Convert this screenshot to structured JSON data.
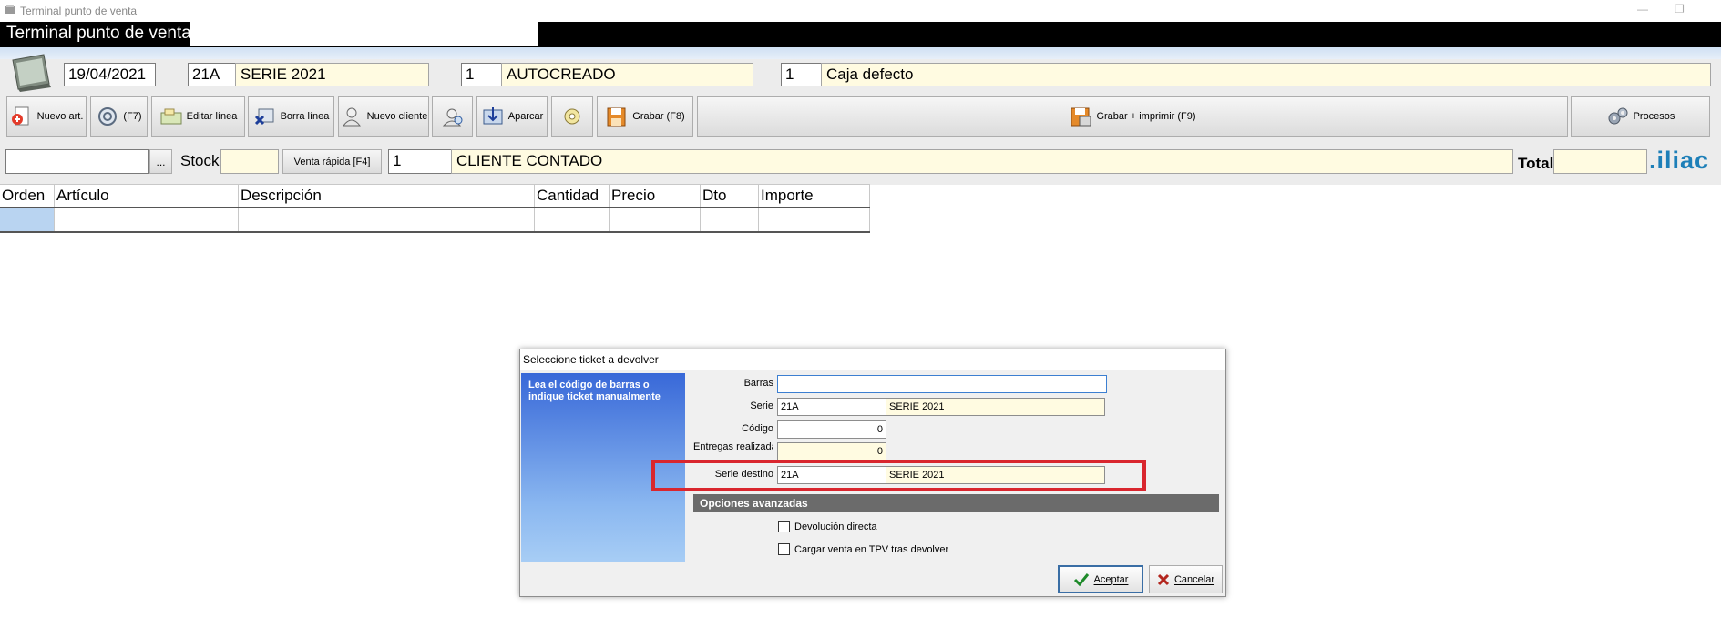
{
  "window": {
    "title": "Terminal punto de venta",
    "app_header": "Terminal punto de venta."
  },
  "header_fields": {
    "date": "19/04/2021",
    "serie_code": "21A",
    "serie_name": "SERIE 2021",
    "user_code": "1",
    "user_name": "AUTOCREADO",
    "caja_code": "1",
    "caja_name": "Caja defecto"
  },
  "toolbar": {
    "nuevo_art": "Nuevo art.",
    "f7": "(F7)",
    "editar_linea": "Editar línea",
    "borra_linea": "Borra línea",
    "nuevo_cliente": "Nuevo cliente",
    "aparcar": "Aparcar",
    "grabar": "Grabar (F8)",
    "grabar_imprimir": "Grabar + imprimir (F9)",
    "procesos": "Procesos"
  },
  "search_row": {
    "article_value": "",
    "ellipsis": "...",
    "stock_label": "Stock",
    "stock_value": "",
    "venta_rapida": "Venta rápida [F4]",
    "client_code": "1",
    "client_name": "CLIENTE CONTADO",
    "total_label": "Total",
    "total_value": "",
    "brand": ".iliac"
  },
  "grid": {
    "columns": [
      "Orden",
      "Artículo",
      "Descripción",
      "Cantidad",
      "Precio",
      "Dto",
      "Importe"
    ]
  },
  "dialog": {
    "title": "Seleccione ticket a devolver",
    "instruction": "Lea el código de barras o indique ticket manualmente",
    "barras_label": "Barras",
    "barras_value": "",
    "serie_label": "Serie",
    "serie_code": "21A",
    "serie_name": "SERIE 2021",
    "codigo_label": "Código",
    "codigo_value": "0",
    "entregas_label": "Entregas realizadas",
    "entregas_value": "0",
    "serie_destino_label": "Serie destino",
    "serie_destino_code": "21A",
    "serie_destino_name": "SERIE 2021",
    "advanced_header": "Opciones avanzadas",
    "devolucion_directa": "Devolución directa",
    "cargar_venta": "Cargar venta en TPV tras devolver",
    "aceptar": "Aceptar",
    "cancelar": "Cancelar",
    "highlight_color": "#d9262e"
  }
}
